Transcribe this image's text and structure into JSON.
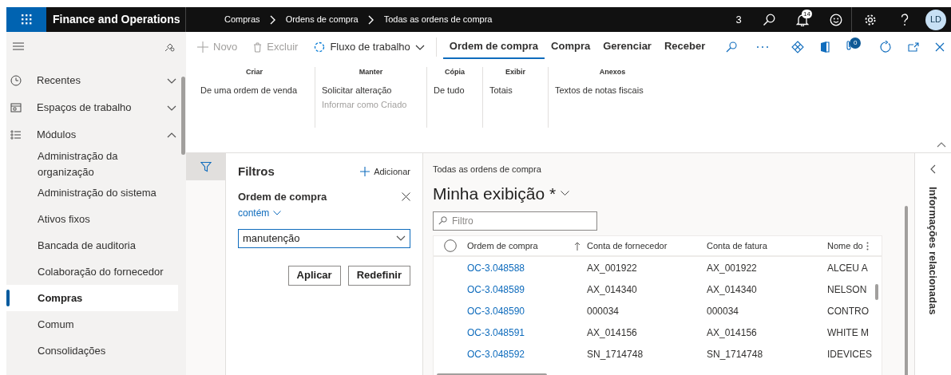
{
  "header": {
    "app_title": "Finance and Operations",
    "breadcrumbs": [
      "Compras",
      "Ordens de compra",
      "Todas as ordens de compra"
    ],
    "company": "3",
    "notification_count": "14",
    "avatar": "LD"
  },
  "sidebar": {
    "nav": [
      {
        "label": "Recentes",
        "kind": "clock",
        "expanded": false
      },
      {
        "label": "Espaços de trabalho",
        "kind": "workspace",
        "expanded": false
      },
      {
        "label": "Módulos",
        "kind": "list",
        "expanded": true
      }
    ],
    "modules": [
      {
        "label": "Administração da organização",
        "selected": false
      },
      {
        "label": "Administração do sistema",
        "selected": false
      },
      {
        "label": "Ativos fixos",
        "selected": false
      },
      {
        "label": "Bancada de auditoria",
        "selected": false
      },
      {
        "label": "Colaboração do fornecedor",
        "selected": false
      },
      {
        "label": "Compras",
        "selected": true
      },
      {
        "label": "Comum",
        "selected": false
      },
      {
        "label": "Consolidações",
        "selected": false
      }
    ]
  },
  "action_pane": {
    "buttons": [
      {
        "label": "Novo",
        "kind": "new",
        "disabled": true
      },
      {
        "label": "Excluir",
        "kind": "delete",
        "disabled": true
      },
      {
        "label": "Fluxo de trabalho",
        "kind": "workflow",
        "disabled": false
      }
    ],
    "tabs": [
      {
        "label": "Ordem de compra",
        "selected": true
      },
      {
        "label": "Compra",
        "selected": false
      },
      {
        "label": "Gerenciar",
        "selected": false
      },
      {
        "label": "Receber",
        "selected": false
      }
    ],
    "attachments_count": "0",
    "groups": [
      {
        "title": "Criar",
        "items": [
          {
            "label": "De uma ordem de venda",
            "disabled": false
          }
        ]
      },
      {
        "title": "Manter",
        "items": [
          {
            "label": "Solicitar alteração",
            "disabled": false
          },
          {
            "label": "Informar como Criado",
            "disabled": true
          }
        ]
      },
      {
        "title": "Cópia",
        "items": [
          {
            "label": "De tudo",
            "disabled": false
          }
        ]
      },
      {
        "title": "Exibir",
        "items": [
          {
            "label": "Totais",
            "disabled": false
          }
        ]
      },
      {
        "title": "Anexos",
        "items": [
          {
            "label": "Textos de notas fiscais",
            "disabled": false
          }
        ]
      }
    ]
  },
  "filters": {
    "title": "Filtros",
    "add_label": "Adicionar",
    "field": "Ordem de compra",
    "operator": "contém",
    "value": "manutenção",
    "buttons": [
      "Aplicar",
      "Redefinir"
    ]
  },
  "grid": {
    "caption": "Todas as ordens de compra",
    "view": "Minha exibição *",
    "search": {
      "placeholder": "Filtro"
    },
    "select_all_checked": false,
    "columns": [
      "Ordem de compra",
      "Conta de fornecedor",
      "Conta de fatura",
      "Nome do"
    ],
    "rows": [
      [
        "OC-3.048588",
        "AX_001922",
        "AX_001922",
        "ALCEU A"
      ],
      [
        "OC-3.048589",
        "AX_014340",
        "AX_014340",
        "NELSON"
      ],
      [
        "OC-3.048590",
        "000034",
        "000034",
        "CONTRO"
      ],
      [
        "OC-3.048591",
        "AX_014156",
        "AX_014156",
        "WHITE M"
      ],
      [
        "OC-3.048592",
        "SN_1714748",
        "SN_1714748",
        "IDEVICES"
      ]
    ]
  },
  "related_panel": {
    "title": "Informações relacionadas"
  }
}
